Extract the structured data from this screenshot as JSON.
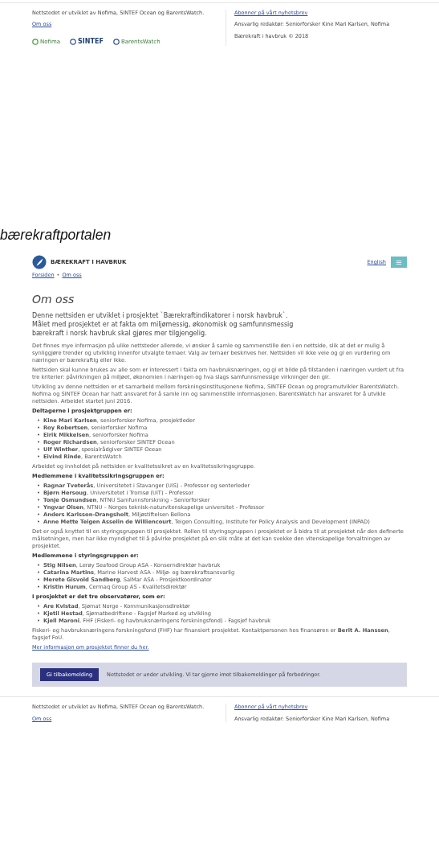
{
  "top_footer": {
    "credit": "Nettstedet er utviklet av Nofima, SINTEF Ocean og BarentsWatch.",
    "about_link": "Om oss",
    "logos": [
      "Nofima",
      "SINTEF",
      "BarentsWatch"
    ],
    "subscribe_link": "Abonner på vårt nyhetsbrev",
    "editor": "Ansvarlig redaktør: Seniorforsker Kine Mari Karlsen, Nofima",
    "copyright": "Bærekraft i havbruk © 2018"
  },
  "caption": "bærekraftportalen",
  "site": {
    "logo_text": "BÆREKRAFT I HAVBRUK",
    "language_link": "English",
    "breadcrumb": [
      "Forsiden",
      "Om oss"
    ],
    "breadcrumb_separator": "•",
    "bullet": "•",
    "heading": "Om oss",
    "lead": "Denne nettsiden er utviklet i prosjektet `Bærekraftindikatorer i norsk havbruk`. Målet med prosjektet er at fakta om miljømessig, økonomisk og samfunnsmessig bærekraft i norsk havbruk skal gjøres mer tilgjengelig.",
    "blocks": [
      {
        "kind": "paragraph",
        "text": "Det finnes mye informasjon på ulike nettsteder allerede, vi ønsker å samle og sammenstille den i en nettside, slik at det er mulig å synliggjøre trender og utvikling innenfor utvalgte temaer. Valg av temaer beskrives her. Nettsiden vil ikke veie og gi en vurdering om næringen er bærekraftig eller ikke."
      },
      {
        "kind": "paragraph",
        "text": "Nettsiden skal kunne brukes av alle som er interessert i fakta om havbruksnæringen, og gi et bilde på tilstanden i næringen vurdert ut fra tre kriterier: påvirkningen på miljøet, økonomien i næringen og hva slags samfunnsmessige virkninger den gir."
      },
      {
        "kind": "paragraph",
        "text": "Utvikling av denne nettsiden er et samarbeid mellom forskningsinstitusjonene Nofima, SINTEF Ocean og programutvikler BarentsWatch. Nofima og SINTEF Ocean har hatt ansvaret for å samle inn og sammenstille informasjonen. BarentsWatch har ansvaret for å utvikle nettsiden. Arbeidet startet juni 2016."
      },
      {
        "kind": "heading",
        "text": "Deltagerne i prosjektgruppen er:"
      },
      {
        "kind": "list",
        "items": [
          "**Kine Mari Karlsen**, seniorforsker Nofima, prosjektleder",
          "**Roy Robertsen**, seniorforsker Nofima",
          "**Eirik Mikkelsen**, seniorforsker Nofima",
          "**Roger Richardsen**, seniorforsker SINTEF Ocean",
          "**Ulf Winther**, spesialrådgiver SINTEF Ocean",
          "**Eivind Rinde**, BarentsWatch"
        ]
      },
      {
        "kind": "paragraph",
        "text": "Arbeidet og innholdet på nettsiden er kvalitetssikret av en kvalitetssikringsgruppe."
      },
      {
        "kind": "heading",
        "text": "Medlemmene i kvalitetssikringsgruppen er:"
      },
      {
        "kind": "list",
        "items": [
          "**Ragnar Tveterås**, Universitetet i Stavanger (UiS) - Professor og senterleder",
          "**Bjørn Hersoug**, Universitetet i Tromsø (UiT) - Professor",
          "**Tonje Osmundsen**, NTNU Samfunnsforskning - Seniorforsker",
          "**Yngvar Olsen**, NTNU – Norges teknisk-naturvitenskapelige universitet - Professor",
          "**Anders Karlsson-Drangsholt**, Miljøstiftelsen Bellona",
          "**Anne Mette Teigen Asselin de Williencourt**, Teigen Consulting, Institute for Policy Analysis and Development (INPAD)"
        ]
      },
      {
        "kind": "paragraph",
        "text": "Det er også knyttet til en styringsgruppen til prosjektet. Rollen til styringsgruppen i prosjektet er å bidra til at prosjektet når den definerte målsetningen, men har ikke myndighet til å påvirke prosjektet på en slik måte at det kan svekke den vitenskapelige forvaltningen av prosjektet."
      },
      {
        "kind": "heading",
        "text": "Medlemmene i styringsgruppen er:"
      },
      {
        "kind": "list",
        "items": [
          "**Stig Nilsen**, Lerøy Seafood Group ASA - Konserndirektør havbruk",
          "**Catarina Martins**, Marine Harvest ASA - Miljø- og bærekraftsansvarlig",
          "**Merete Gisvold Sandberg**, SalMar ASA - Prosjektkoordinator",
          "**Kristin Hurum**, Cermaq Group AS - Kvalitetsdirektør"
        ]
      },
      {
        "kind": "heading",
        "text": "I prosjektet er det tre observatører, som er:"
      },
      {
        "kind": "list",
        "items": [
          "**Are Kvistad**, Sjømat Norge - Kommunikasjonsdirektør",
          "**Kjetil Hestad**, Sjømatbedriftene - Fagsjef Marked og utvikling",
          "**Kjell Maroni**, FHF (Fiskeri- og havbruksnæringens forskningsfond) - Fagsjef havbruk"
        ]
      },
      {
        "kind": "paragraph",
        "text": "Fiskeri- og havbruksnæringens forskningsfond (FHF) har finansiert prosjektet. Kontaktpersonen hos finansøren er **Berit A. Hanssen**, fagsjef FoU."
      },
      {
        "kind": "link",
        "text": "Mer informasjon om prosjektet finner du her."
      }
    ],
    "feedback": {
      "button": "Gi tilbakemelding",
      "text": "Nettstedet er under utvikling. Vi tar gjerne imot tilbakemeldinger på forbedringer."
    },
    "footer": {
      "credit": "Nettstedet er utviklet av Nofima, SINTEF Ocean og BarentsWatch.",
      "about_link": "Om oss",
      "subscribe_link": "Abonner på vårt nyhetsbrev",
      "editor": "Ansvarlig redaktør: Seniorforsker Kine Mari Karlsen, Nofima"
    }
  }
}
